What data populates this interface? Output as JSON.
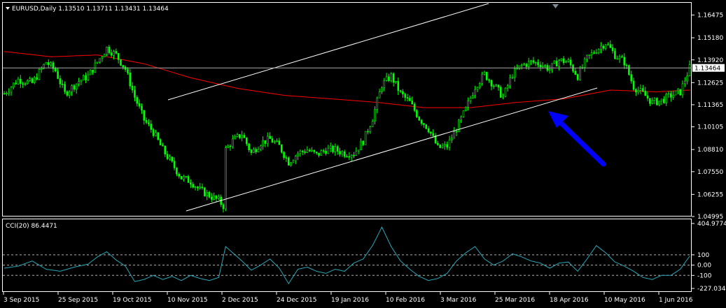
{
  "chart_data": [
    {
      "type": "candlestick",
      "header": "EURUSD,Daily  1.13510 1.13711 1.13431 1.13464",
      "ylim": [
        1.04995,
        1.16935
      ],
      "price_ticks": [
        "1.16475",
        "1.15180",
        "1.13920",
        "1.12625",
        "1.11365",
        "1.10105",
        "1.08810",
        "1.07550",
        "1.06255",
        "1.04995"
      ],
      "current_price_label": "1.13464",
      "current_price": 1.13464,
      "x_ticks": [
        "3 Sep 2015",
        "25 Sep 2015",
        "19 Oct 2015",
        "10 Nov 2015",
        "2 Dec 2015",
        "24 Dec 2015",
        "19 Jan 2016",
        "10 Feb 2016",
        "3 Mar 2016",
        "25 Mar 2016",
        "18 Apr 2016",
        "10 May 2016",
        "1 Jun 2016"
      ],
      "candle_color": "#00ff00",
      "ma_color": "#ff0000",
      "channel_color": "#ffffff",
      "arrow_color": "#0000ff",
      "close_path": [
        [
          0,
          1.12
        ],
        [
          6,
          1.128
        ],
        [
          12,
          1.126
        ],
        [
          18,
          1.138
        ],
        [
          22,
          1.133
        ],
        [
          26,
          1.12
        ],
        [
          32,
          1.127
        ],
        [
          36,
          1.13
        ],
        [
          40,
          1.138
        ],
        [
          44,
          1.146
        ],
        [
          48,
          1.142
        ],
        [
          52,
          1.134
        ],
        [
          56,
          1.118
        ],
        [
          60,
          1.105
        ],
        [
          64,
          1.098
        ],
        [
          68,
          1.088
        ],
        [
          72,
          1.08
        ],
        [
          76,
          1.072
        ],
        [
          80,
          1.07
        ],
        [
          84,
          1.065
        ],
        [
          88,
          1.062
        ],
        [
          92,
          1.059
        ],
        [
          94,
          1.056
        ],
        [
          95,
          1.088
        ],
        [
          98,
          1.093
        ],
        [
          102,
          1.097
        ],
        [
          106,
          1.086
        ],
        [
          110,
          1.092
        ],
        [
          114,
          1.094
        ],
        [
          118,
          1.09
        ],
        [
          122,
          1.081
        ],
        [
          126,
          1.086
        ],
        [
          130,
          1.088
        ],
        [
          134,
          1.085
        ],
        [
          138,
          1.088
        ],
        [
          142,
          1.088
        ],
        [
          146,
          1.086
        ],
        [
          150,
          1.086
        ],
        [
          154,
          1.093
        ],
        [
          158,
          1.106
        ],
        [
          162,
          1.125
        ],
        [
          166,
          1.13
        ],
        [
          170,
          1.12
        ],
        [
          174,
          1.115
        ],
        [
          178,
          1.106
        ],
        [
          182,
          1.1
        ],
        [
          186,
          1.089
        ],
        [
          190,
          1.09
        ],
        [
          194,
          1.1
        ],
        [
          198,
          1.111
        ],
        [
          202,
          1.124
        ],
        [
          206,
          1.131
        ],
        [
          210,
          1.125
        ],
        [
          214,
          1.118
        ],
        [
          218,
          1.131
        ],
        [
          222,
          1.136
        ],
        [
          226,
          1.138
        ],
        [
          230,
          1.137
        ],
        [
          234,
          1.134
        ],
        [
          238,
          1.139
        ],
        [
          242,
          1.138
        ],
        [
          246,
          1.13
        ],
        [
          250,
          1.14
        ],
        [
          254,
          1.145
        ],
        [
          258,
          1.149
        ],
        [
          262,
          1.142
        ],
        [
          266,
          1.138
        ],
        [
          270,
          1.124
        ],
        [
          274,
          1.12
        ],
        [
          278,
          1.115
        ],
        [
          282,
          1.116
        ],
        [
          286,
          1.119
        ],
        [
          290,
          1.121
        ],
        [
          294,
          1.1346
        ]
      ],
      "ma_path": [
        [
          0,
          1.144
        ],
        [
          20,
          1.141
        ],
        [
          40,
          1.142
        ],
        [
          60,
          1.137
        ],
        [
          80,
          1.129
        ],
        [
          100,
          1.123
        ],
        [
          120,
          1.119
        ],
        [
          140,
          1.117
        ],
        [
          160,
          1.115
        ],
        [
          180,
          1.112
        ],
        [
          200,
          1.112
        ],
        [
          220,
          1.115
        ],
        [
          240,
          1.117
        ],
        [
          260,
          1.122
        ],
        [
          280,
          1.121
        ],
        [
          294,
          1.122
        ]
      ],
      "bar_count": 295
    },
    {
      "type": "line",
      "header": "CCI(20) 86.4471",
      "ylim": [
        -227.0348,
        404.9774
      ],
      "ticks": [
        "404.9774",
        "100",
        "0.00",
        "-100",
        "-227.0348"
      ],
      "levels": [
        100,
        0,
        -100
      ],
      "line_color": "#2aa7b8",
      "series_points": [
        [
          0,
          -30
        ],
        [
          6,
          -10
        ],
        [
          12,
          40
        ],
        [
          18,
          -40
        ],
        [
          24,
          -60
        ],
        [
          30,
          -20
        ],
        [
          36,
          10
        ],
        [
          40,
          80
        ],
        [
          44,
          130
        ],
        [
          48,
          50
        ],
        [
          52,
          -10
        ],
        [
          56,
          -160
        ],
        [
          60,
          -140
        ],
        [
          64,
          -100
        ],
        [
          68,
          -140
        ],
        [
          72,
          -110
        ],
        [
          76,
          -150
        ],
        [
          80,
          -100
        ],
        [
          84,
          -130
        ],
        [
          88,
          -150
        ],
        [
          92,
          -120
        ],
        [
          95,
          180
        ],
        [
          98,
          120
        ],
        [
          102,
          40
        ],
        [
          106,
          -50
        ],
        [
          110,
          0
        ],
        [
          114,
          60
        ],
        [
          118,
          -30
        ],
        [
          122,
          -180
        ],
        [
          126,
          -40
        ],
        [
          130,
          -20
        ],
        [
          134,
          -60
        ],
        [
          138,
          -80
        ],
        [
          142,
          -40
        ],
        [
          146,
          -60
        ],
        [
          150,
          20
        ],
        [
          154,
          60
        ],
        [
          158,
          190
        ],
        [
          162,
          370
        ],
        [
          166,
          180
        ],
        [
          170,
          40
        ],
        [
          174,
          -40
        ],
        [
          178,
          -110
        ],
        [
          182,
          -150
        ],
        [
          186,
          -130
        ],
        [
          190,
          -80
        ],
        [
          194,
          40
        ],
        [
          198,
          120
        ],
        [
          202,
          180
        ],
        [
          206,
          60
        ],
        [
          210,
          0
        ],
        [
          214,
          40
        ],
        [
          218,
          110
        ],
        [
          222,
          80
        ],
        [
          226,
          40
        ],
        [
          230,
          20
        ],
        [
          234,
          -30
        ],
        [
          238,
          20
        ],
        [
          242,
          30
        ],
        [
          246,
          -60
        ],
        [
          250,
          60
        ],
        [
          254,
          190
        ],
        [
          258,
          120
        ],
        [
          262,
          30
        ],
        [
          266,
          -10
        ],
        [
          270,
          -60
        ],
        [
          274,
          -120
        ],
        [
          278,
          -140
        ],
        [
          282,
          -100
        ],
        [
          286,
          -100
        ],
        [
          290,
          -40
        ],
        [
          294,
          86.4471
        ]
      ]
    }
  ]
}
